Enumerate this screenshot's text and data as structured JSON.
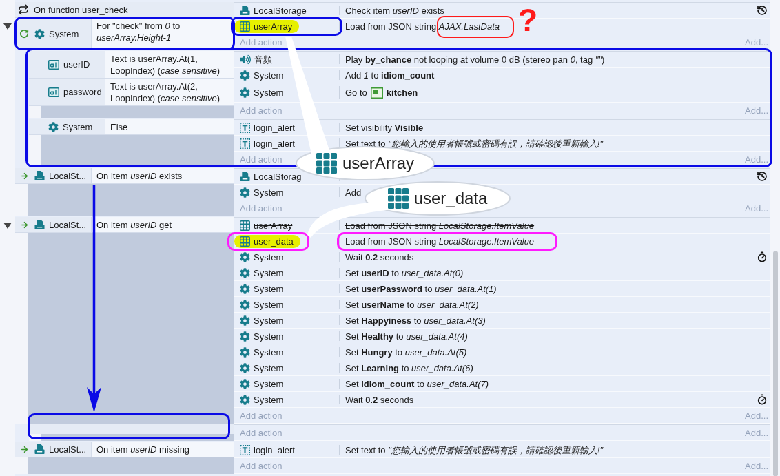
{
  "events": [
    {
      "expanded": true,
      "header": "On function user_check",
      "conditions": [
        {
          "kind": "loop",
          "object": "System",
          "text": "For \"check\" from *0* to *userArray.Height-1*"
        }
      ],
      "actions": [
        {
          "kind": "storage",
          "object": "LocalStorage",
          "text": "Check item *userID* exists",
          "disabled": false,
          "highlighted": false
        },
        {
          "kind": "array",
          "object": "userArray",
          "text": "Load from JSON string *AJAX.LastData*",
          "disabled": false,
          "highlighted": true
        }
      ],
      "add_action": "Add action",
      "add_more": "Add...",
      "children": [
        {
          "conditions": [
            {
              "kind": "textinput",
              "object": "userID",
              "text": "Text is userArray.At(1, LoopIndex) (*case sensitive*)"
            },
            {
              "kind": "textinput",
              "object": "password",
              "text": "Text is userArray.At(2, LoopIndex) (*case sensitive*)"
            }
          ],
          "actions": [
            {
              "kind": "audio",
              "object": "音頻",
              "text": "Play **by_chance** not looping at volume 0 dB (stereo pan *0*, tag *\"\"*)",
              "disabled": false,
              "highlighted": false
            },
            {
              "kind": "system",
              "object": "System",
              "text": "Add *1* to **idiom_count**",
              "disabled": false,
              "highlighted": false
            },
            {
              "kind": "system",
              "object": "System",
              "text": "Go to",
              "layout": "kitchen",
              "disabled": false,
              "highlighted": false
            }
          ],
          "add_action": "Add action",
          "add_more": "Add..."
        },
        {
          "conditions": [
            {
              "kind": "system",
              "object": "System",
              "text": "Else"
            }
          ],
          "actions": [
            {
              "kind": "text",
              "object": "login_alert",
              "text": "Set visibility **Visible**",
              "disabled": false,
              "highlighted": false
            },
            {
              "kind": "text",
              "object": "login_alert",
              "text": "Set text to *\"您輸入的使用者帳號或密碼有誤，請確認後重新輸入!\"*",
              "disabled": false,
              "highlighted": false
            }
          ],
          "add_action": "Add action",
          "add_more": "Add..."
        }
      ]
    },
    {
      "conditions": [
        {
          "kind": "trigger",
          "object": "LocalSt...",
          "text": "On item *userID* exists"
        }
      ],
      "actions": [
        {
          "kind": "storage",
          "object": "LocalStorag",
          "disabled": false,
          "highlighted": false
        },
        {
          "kind": "system",
          "object": "System",
          "text": "Add",
          "disabled": false,
          "highlighted": false
        }
      ],
      "add_action": "Add action",
      "add_more": "Add..."
    },
    {
      "expanded": true,
      "conditions": [
        {
          "kind": "trigger",
          "object": "LocalSt...",
          "text": "On item *userID* get"
        }
      ],
      "actions": [
        {
          "kind": "array",
          "object": "userArray",
          "text": "Load from JSON string *LocalStorage.ItemValue*",
          "disabled": true,
          "highlighted": false
        },
        {
          "kind": "array",
          "object": "user_data",
          "text": "Load from JSON string *LocalStorage.ItemValue*",
          "disabled": false,
          "highlighted": true
        },
        {
          "kind": "wait",
          "object": "System",
          "text": "Wait **0.2** seconds",
          "disabled": false,
          "highlighted": false
        },
        {
          "kind": "system",
          "object": "System",
          "text": "Set **userID** to *user_data.At(0)*",
          "disabled": false,
          "highlighted": false
        },
        {
          "kind": "system",
          "object": "System",
          "text": "Set **userPassword** to *user_data.At(1)*",
          "disabled": false,
          "highlighted": false
        },
        {
          "kind": "system",
          "object": "System",
          "text": "Set **userName** to *user_data.At(2)*",
          "disabled": false,
          "highlighted": false
        },
        {
          "kind": "system",
          "object": "System",
          "text": "Set **Happyiness** to *user_data.At(3)*",
          "disabled": false,
          "highlighted": false
        },
        {
          "kind": "system",
          "object": "System",
          "text": "Set **Healthy** to *user_data.At(4)*",
          "disabled": false,
          "highlighted": false
        },
        {
          "kind": "system",
          "object": "System",
          "text": "Set **Hungry** to *user_data.At(5)*",
          "disabled": false,
          "highlighted": false
        },
        {
          "kind": "system",
          "object": "System",
          "text": "Set **Learning** to *user_data.At(6)*",
          "disabled": false,
          "highlighted": false
        },
        {
          "kind": "system",
          "object": "System",
          "text": "Set **idiom_count** to *user_data.At(7)*",
          "disabled": false,
          "highlighted": false
        },
        {
          "kind": "wait",
          "object": "System",
          "text": "Wait **0.2** seconds",
          "disabled": false,
          "highlighted": false
        }
      ],
      "add_action": "Add action",
      "add_more": "Add...",
      "children": [
        {
          "add_action": "Add action",
          "add_more": "Add..."
        }
      ]
    },
    {
      "conditions": [
        {
          "kind": "trigger",
          "object": "LocalSt...",
          "text": "On item *userID* missing"
        }
      ],
      "actions": [
        {
          "kind": "text",
          "object": "login_alert",
          "text": "Set text to *\"您輸入的使用者帳號或密碼有誤，請確認後重新輸入!\"*",
          "disabled": false,
          "highlighted": false
        }
      ],
      "add_action": "Add action",
      "add_more": "Add..."
    }
  ],
  "annotations": [
    {
      "kind": "box",
      "color": "#0a0ae6"
    },
    {
      "kind": "box",
      "color": "#0a0ae6"
    },
    {
      "kind": "box",
      "color": "#0a0ae6"
    },
    {
      "kind": "box",
      "color": "#0a0ae6"
    },
    {
      "kind": "box",
      "color": "#ff1a1a"
    },
    {
      "kind": "box",
      "color": "#ff1aff"
    },
    {
      "kind": "box",
      "color": "#ff1aff"
    },
    {
      "kind": "arrow",
      "color": "#0a0ae6"
    },
    {
      "kind": "mark",
      "text": "?",
      "color": "#ff1a1a"
    },
    {
      "kind": "callout",
      "text": "userArray"
    },
    {
      "kind": "callout",
      "text": "user_data"
    }
  ]
}
